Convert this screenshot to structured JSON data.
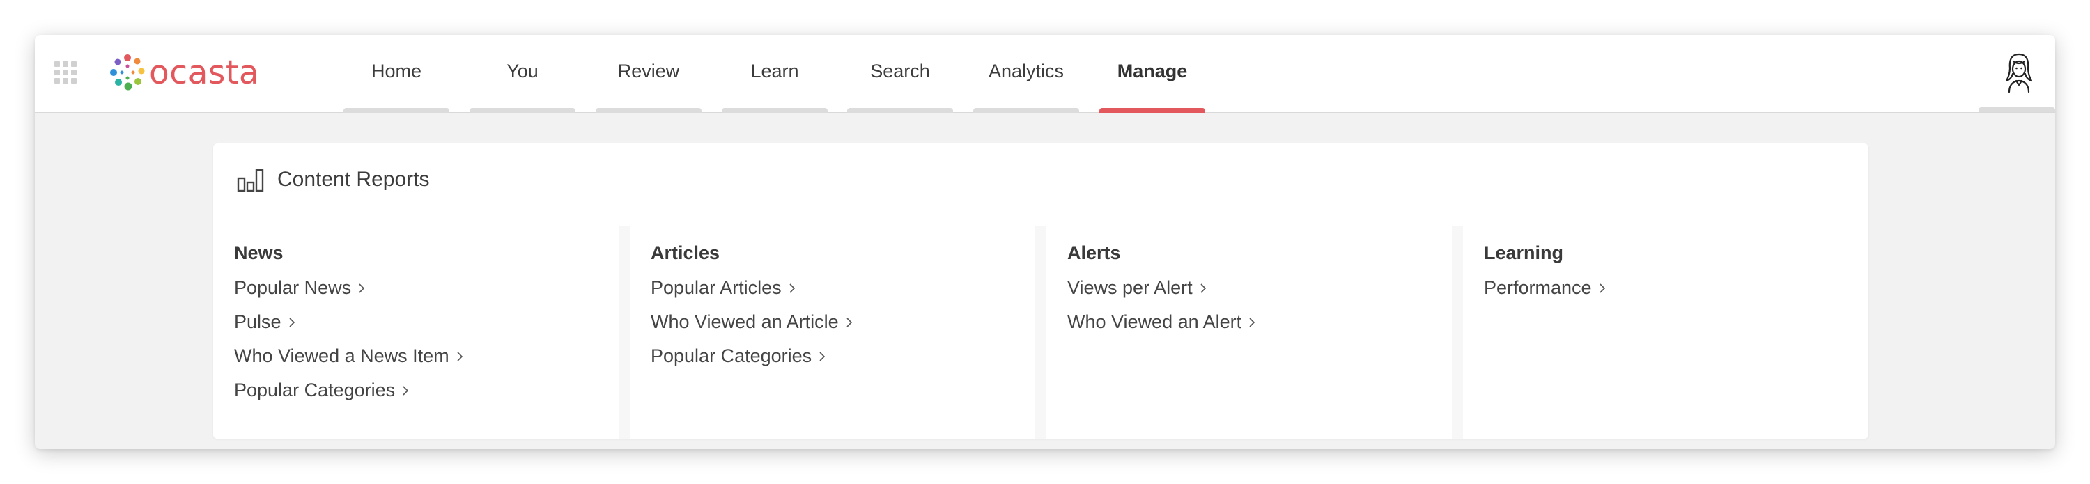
{
  "app": {
    "brand": "ocasta",
    "brand_color": "#e2585c"
  },
  "nav": {
    "tabs": [
      {
        "label": "Home",
        "active": false
      },
      {
        "label": "You",
        "active": false
      },
      {
        "label": "Review",
        "active": false
      },
      {
        "label": "Learn",
        "active": false
      },
      {
        "label": "Search",
        "active": false
      },
      {
        "label": "Analytics",
        "active": false
      },
      {
        "label": "Manage",
        "active": true
      }
    ]
  },
  "icons": {
    "apps": "grid-icon",
    "report": "bar-chart-icon",
    "avatar": "user-avatar",
    "chevron": "chevron-right-icon"
  },
  "report": {
    "title": "Content Reports",
    "columns": [
      {
        "heading": "News",
        "items": [
          "Popular News",
          "Pulse",
          "Who Viewed a News Item",
          "Popular Categories"
        ]
      },
      {
        "heading": "Articles",
        "items": [
          "Popular Articles",
          "Who Viewed an Article",
          "Popular Categories"
        ]
      },
      {
        "heading": "Alerts",
        "items": [
          "Views per Alert",
          "Who Viewed an Alert"
        ]
      },
      {
        "heading": "Learning",
        "items": [
          "Performance"
        ]
      }
    ]
  }
}
